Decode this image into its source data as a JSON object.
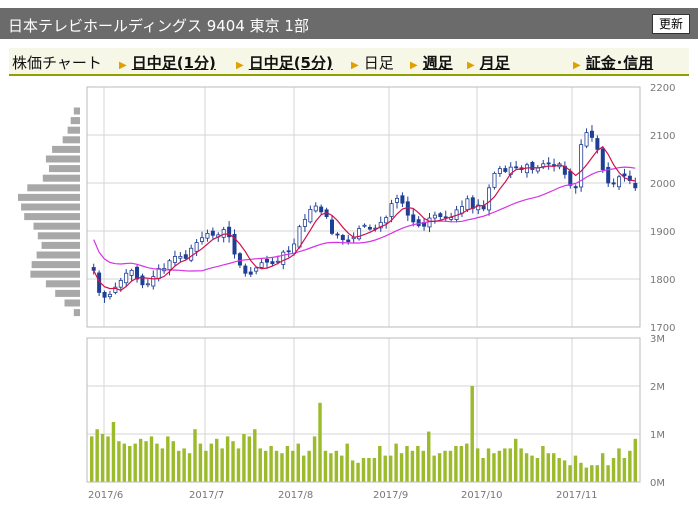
{
  "header": {
    "title": "日本テレビホールディングス  9404  東京 1部",
    "refresh_label": "更新"
  },
  "tabs": [
    {
      "label": "株価チャート",
      "link": false
    },
    {
      "label": "日中足(1分)",
      "link": true
    },
    {
      "label": "日中足(5分)",
      "link": true
    },
    {
      "label": "日足",
      "link": false
    },
    {
      "label": "週足",
      "link": true
    },
    {
      "label": "月足",
      "link": true
    },
    {
      "label": "証金･信用",
      "link": true
    }
  ],
  "colors": {
    "candle": "#1f3f96",
    "ma_short": "#d0104e",
    "ma_long": "#d633e6",
    "volume": "#9cbb2c",
    "volume_profile": "#a8a8a8",
    "grid": "#d6d6d6"
  },
  "chart_data": [
    {
      "type": "candlestick",
      "ylim": [
        1700,
        2200
      ],
      "y_ticks": [
        "2200",
        "2100",
        "2000",
        "1900",
        "1800",
        "1700"
      ],
      "x_ticks": [
        "2017/6",
        "2017/7",
        "2017/8",
        "2017/9",
        "2017/10",
        "2017/11"
      ],
      "close": [
        1818,
        1772,
        1762,
        1768,
        1783,
        1797,
        1812,
        1818,
        1800,
        1788,
        1790,
        1805,
        1822,
        1822,
        1838,
        1847,
        1847,
        1843,
        1864,
        1876,
        1886,
        1895,
        1891,
        1892,
        1903,
        1888,
        1852,
        1829,
        1812,
        1810,
        1823,
        1834,
        1835,
        1832,
        1837,
        1856,
        1857,
        1873,
        1909,
        1924,
        1945,
        1952,
        1940,
        1930,
        1895,
        1892,
        1882,
        1878,
        1887,
        1905,
        1912,
        1904,
        1906,
        1918,
        1928,
        1957,
        1968,
        1958,
        1933,
        1919,
        1911,
        1910,
        1927,
        1933,
        1930,
        1929,
        1928,
        1944,
        1951,
        1967,
        1947,
        1954,
        1946,
        1990,
        2020,
        2030,
        2024,
        2033,
        2033,
        2028,
        2038,
        2028,
        2031,
        2040,
        2040,
        2035,
        2040,
        2018,
        1995,
        1990,
        2080,
        2105,
        2095,
        2070,
        2028,
        2000,
        1998,
        2013,
        2015,
        2005,
        1990
      ],
      "volume_profile": [
        {
          "price": 2150,
          "volume": 0.1
        },
        {
          "price": 2130,
          "volume": 0.15
        },
        {
          "price": 2110,
          "volume": 0.2
        },
        {
          "price": 2090,
          "volume": 0.28
        },
        {
          "price": 2070,
          "volume": 0.45
        },
        {
          "price": 2050,
          "volume": 0.55
        },
        {
          "price": 2030,
          "volume": 0.5
        },
        {
          "price": 2010,
          "volume": 0.6
        },
        {
          "price": 1990,
          "volume": 0.85
        },
        {
          "price": 1970,
          "volume": 1.0
        },
        {
          "price": 1950,
          "volume": 0.95
        },
        {
          "price": 1930,
          "volume": 0.9
        },
        {
          "price": 1910,
          "volume": 0.75
        },
        {
          "price": 1890,
          "volume": 0.68
        },
        {
          "price": 1870,
          "volume": 0.62
        },
        {
          "price": 1850,
          "volume": 0.7
        },
        {
          "price": 1830,
          "volume": 0.78
        },
        {
          "price": 1810,
          "volume": 0.8
        },
        {
          "price": 1790,
          "volume": 0.55
        },
        {
          "price": 1770,
          "volume": 0.4
        },
        {
          "price": 1750,
          "volume": 0.25
        },
        {
          "price": 1730,
          "volume": 0.1
        }
      ]
    },
    {
      "type": "bar",
      "ylim": [
        0,
        3000000
      ],
      "y_ticks": [
        "3M",
        "2M",
        "1M",
        "0M"
      ],
      "values": [
        950000,
        1100000,
        1000000,
        950000,
        1250000,
        850000,
        800000,
        750000,
        800000,
        900000,
        850000,
        950000,
        800000,
        700000,
        950000,
        850000,
        650000,
        700000,
        600000,
        1100000,
        800000,
        650000,
        800000,
        900000,
        700000,
        950000,
        850000,
        700000,
        1000000,
        950000,
        1100000,
        700000,
        650000,
        750000,
        650000,
        600000,
        750000,
        650000,
        800000,
        550000,
        650000,
        950000,
        1650000,
        650000,
        600000,
        650000,
        550000,
        800000,
        450000,
        400000,
        500000,
        500000,
        500000,
        750000,
        550000,
        550000,
        800000,
        600000,
        750000,
        650000,
        750000,
        650000,
        1050000,
        550000,
        600000,
        650000,
        650000,
        750000,
        750000,
        800000,
        2000000,
        700000,
        500000,
        700000,
        600000,
        650000,
        700000,
        700000,
        900000,
        700000,
        600000,
        550000,
        500000,
        750000,
        600000,
        600000,
        500000,
        450000,
        350000,
        550000,
        400000,
        300000,
        350000,
        350000,
        600000,
        350000,
        500000,
        700000,
        500000,
        650000,
        900000
      ]
    }
  ]
}
